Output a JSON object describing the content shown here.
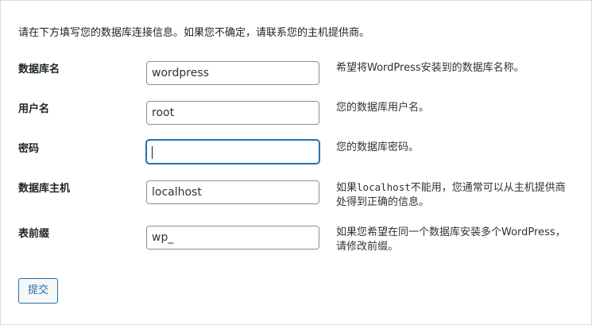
{
  "intro": "请在下方填写您的数据库连接信息。如果您不确定，请联系您的主机提供商。",
  "fields": [
    {
      "label": "数据库名",
      "value": "wordpress",
      "description": "希望将WordPress安装到的数据库名称。"
    },
    {
      "label": "用户名",
      "value": "root",
      "description": "您的数据库用户名。"
    },
    {
      "label": "密码",
      "value": "",
      "description": "您的数据库密码。"
    },
    {
      "label": "数据库主机",
      "value": "localhost",
      "description_prefix": "如果",
      "description_code": "localhost",
      "description_suffix": "不能用，您通常可以从主机提供商处得到正确的信息。"
    },
    {
      "label": "表前缀",
      "value": "wp_",
      "description": "如果您希望在同一个数据库安装多个WordPress，请修改前缀。"
    }
  ],
  "submit_label": "提交",
  "colors": {
    "accent": "#2271b1",
    "input_border": "#8c8f94",
    "panel_border": "#dcdcde",
    "page_bg": "#f0f0f1"
  }
}
